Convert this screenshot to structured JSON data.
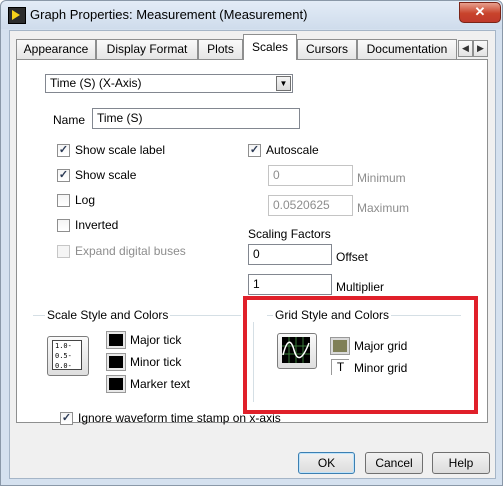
{
  "window": {
    "title": "Graph Properties: Measurement (Measurement)",
    "close_glyph": "✕"
  },
  "tabs": [
    {
      "label": "Appearance",
      "active": false
    },
    {
      "label": "Display Format",
      "active": false
    },
    {
      "label": "Plots",
      "active": false
    },
    {
      "label": "Scales",
      "active": true
    },
    {
      "label": "Cursors",
      "active": false
    },
    {
      "label": "Documentation",
      "active": false
    }
  ],
  "tab_scroll": {
    "left_glyph": "◀",
    "right_glyph": "▶"
  },
  "scales": {
    "axis_select": {
      "value": "Time (S) (X-Axis)",
      "drop_glyph": "▼"
    },
    "name_label": "Name",
    "name_value": "Time (S)",
    "show_scale_label": {
      "label": "Show scale label",
      "checked": true
    },
    "show_scale": {
      "label": "Show scale",
      "checked": true
    },
    "log": {
      "label": "Log",
      "checked": false
    },
    "inverted": {
      "label": "Inverted",
      "checked": false
    },
    "expand_digital_buses": {
      "label": "Expand digital buses",
      "checked": false,
      "enabled": false
    },
    "autoscale": {
      "label": "Autoscale",
      "checked": true
    },
    "minimum": {
      "value": "0",
      "label": "Minimum",
      "enabled": false
    },
    "maximum": {
      "value": "0.0520625",
      "label": "Maximum",
      "enabled": false
    },
    "scaling_factors": {
      "title": "Scaling Factors",
      "offset_value": "0",
      "offset_label": "Offset",
      "multiplier_value": "1",
      "multiplier_label": "Multiplier"
    },
    "scale_style": {
      "title": "Scale Style and Colors",
      "preview_ticks": [
        "1.0-",
        "0.5-",
        "0.0-"
      ],
      "major_tick": "Major tick",
      "minor_tick": "Minor tick",
      "marker_text": "Marker text"
    },
    "grid_style": {
      "title": "Grid Style and Colors",
      "major_grid": "Major grid",
      "minor_grid": "Minor grid",
      "major_grid_color": "#7f7f57",
      "minor_grid_glyph": "T"
    },
    "ignore_timestamp": {
      "label": "Ignore waveform time stamp on x-axis",
      "checked": true
    }
  },
  "buttons": {
    "ok": "OK",
    "cancel": "Cancel",
    "help": "Help"
  },
  "colors": {
    "highlight": "#e0202a",
    "titlebar": "#cfdcec",
    "close": "#c8432b"
  }
}
